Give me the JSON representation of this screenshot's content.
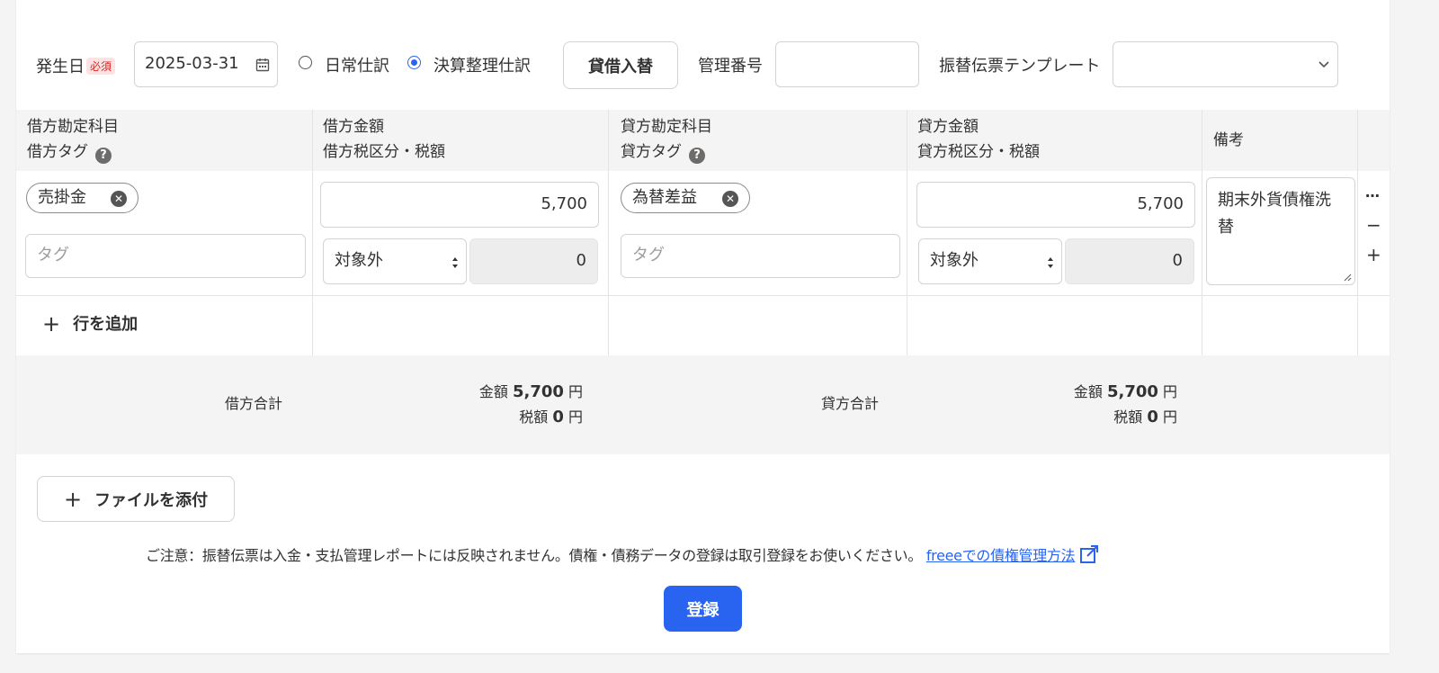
{
  "header": {
    "date_label": "発生日",
    "required_badge": "必須",
    "date_value": "2025-03-31",
    "radio_normal": "日常仕訳",
    "radio_closing": "決算整理仕訳",
    "swap_button": "貸借入替",
    "mgmt_label": "管理番号",
    "mgmt_value": "",
    "template_label": "振替伝票テンプレート",
    "template_value": ""
  },
  "columns": {
    "debit_account": "借方勘定科目",
    "debit_tag": "借方タグ",
    "debit_amount": "借方金額",
    "debit_tax": "借方税区分・税額",
    "credit_account": "貸方勘定科目",
    "credit_tag": "貸方タグ",
    "credit_amount": "貸方金額",
    "credit_tax": "貸方税区分・税額",
    "memo": "備考"
  },
  "row": {
    "debit_account": "売掛金",
    "debit_tag_placeholder": "タグ",
    "debit_amount": "5,700",
    "debit_tax_class": "対象外",
    "debit_tax_amount": "0",
    "credit_account": "為替差益",
    "credit_tag_placeholder": "タグ",
    "credit_amount": "5,700",
    "credit_tax_class": "対象外",
    "credit_tax_amount": "0",
    "memo": "期末外貨債権洗替"
  },
  "row_actions": {
    "more": "…",
    "remove": "−",
    "add": "+"
  },
  "add_row": "行を追加",
  "totals": {
    "debit_label": "借方合計",
    "credit_label": "貸方合計",
    "amount_label": "金額",
    "tax_label": "税額",
    "unit": "円",
    "debit_amount": "5,700",
    "debit_tax": "0",
    "credit_amount": "5,700",
    "credit_tax": "0"
  },
  "attach_button": "ファイルを添付",
  "notice": "ご注意：振替伝票は入金・支払管理レポートには反映されません。債権・債務データの登録は取引登録をお使いください。",
  "notice_link": "freeeでの債権管理方法",
  "submit_button": "登録",
  "colors": {
    "primary": "#2864f0",
    "header_bg": "#f5f4f4"
  }
}
